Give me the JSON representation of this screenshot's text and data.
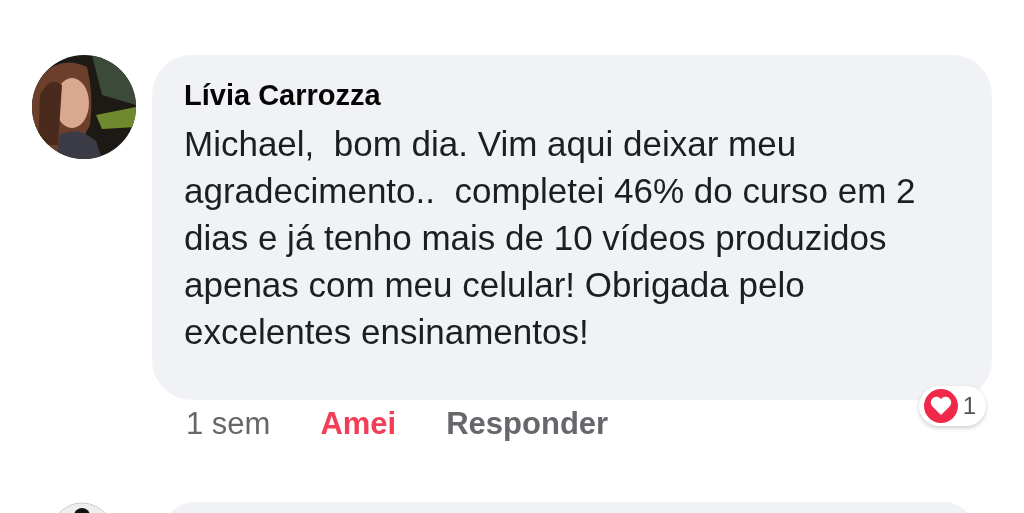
{
  "comment": {
    "author": "Lívia Carrozza",
    "text": "Michael,  bom dia. Vim aqui deixar meu agradecimento..  completei 46% do curso em 2 dias e já tenho mais de 10 vídeos produzidos apenas com meu celular! Obrigada pelo excelentes ensinamentos!",
    "time": "1 sem",
    "reaction": {
      "label": "Amei",
      "selected": true
    },
    "reply": "Responder",
    "reaction_count": "1"
  }
}
